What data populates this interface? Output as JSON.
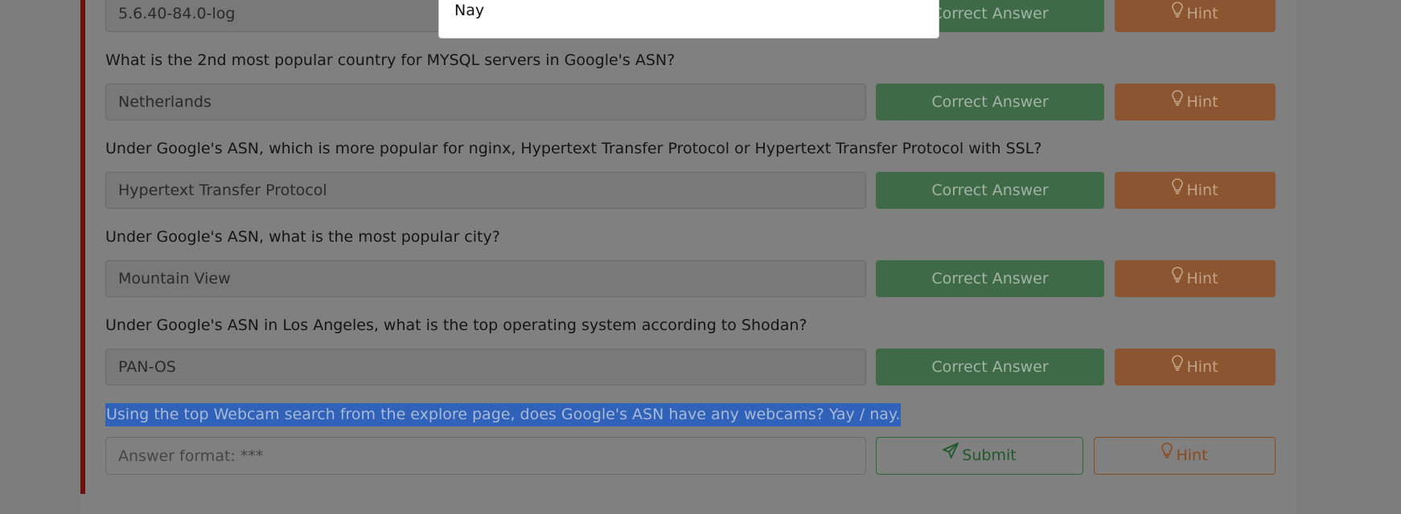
{
  "popup": {
    "option_text": "Nay"
  },
  "questions": [
    {
      "text": "",
      "answer": "5.6.40-84.0-log",
      "correct_label": "Correct Answer",
      "hint_label": "Hint"
    },
    {
      "text": "What is the 2nd most popular country for MYSQL servers in Google's ASN?",
      "answer": "Netherlands",
      "correct_label": "Correct Answer",
      "hint_label": "Hint"
    },
    {
      "text": "Under Google's ASN, which is more popular for nginx, Hypertext Transfer Protocol or Hypertext Transfer Protocol with SSL?",
      "answer": "Hypertext Transfer Protocol",
      "correct_label": "Correct Answer",
      "hint_label": "Hint"
    },
    {
      "text": "Under Google's ASN, what is the most popular city?",
      "answer": "Mountain View",
      "correct_label": "Correct Answer",
      "hint_label": "Hint"
    },
    {
      "text": "Under Google's ASN in Los Angeles, what is the top operating system according to Shodan?",
      "answer": "PAN-OS",
      "correct_label": "Correct Answer",
      "hint_label": "Hint"
    }
  ],
  "current_question": {
    "text": "Using the top Webcam search from the explore page, does Google's ASN have any webcams? Yay / nay.",
    "placeholder": "Answer format: ***",
    "submit_label": "Submit",
    "hint_label": "Hint"
  },
  "colors": {
    "correct_button": "#3e6a48",
    "hint_button": "#8a5530",
    "selection_highlight": "#2f62b8",
    "card_accent": "#6e0f10"
  },
  "icons": {
    "hint": "lightbulb-icon",
    "submit": "paper-plane-icon"
  }
}
